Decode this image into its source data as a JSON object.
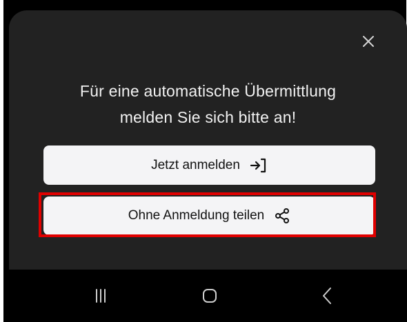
{
  "dialog": {
    "title_line1": "Für eine automatische Übermittlung",
    "title_line2": "melden Sie sich bitte an!",
    "login_button_label": "Jetzt anmelden",
    "share_button_label": "Ohne Anmeldung teilen",
    "close_icon": "close-icon",
    "login_icon": "login-arrow-icon",
    "share_icon": "share-icon"
  },
  "navbar": {
    "recents_icon": "recents-icon",
    "home_icon": "home-icon",
    "back_icon": "back-icon"
  },
  "colors": {
    "sheet_background": "#222222",
    "button_background": "#f4f4f6",
    "highlight": "#e00000",
    "text_light": "#f2f2f2",
    "nav_icons": "#cfcfcf"
  }
}
